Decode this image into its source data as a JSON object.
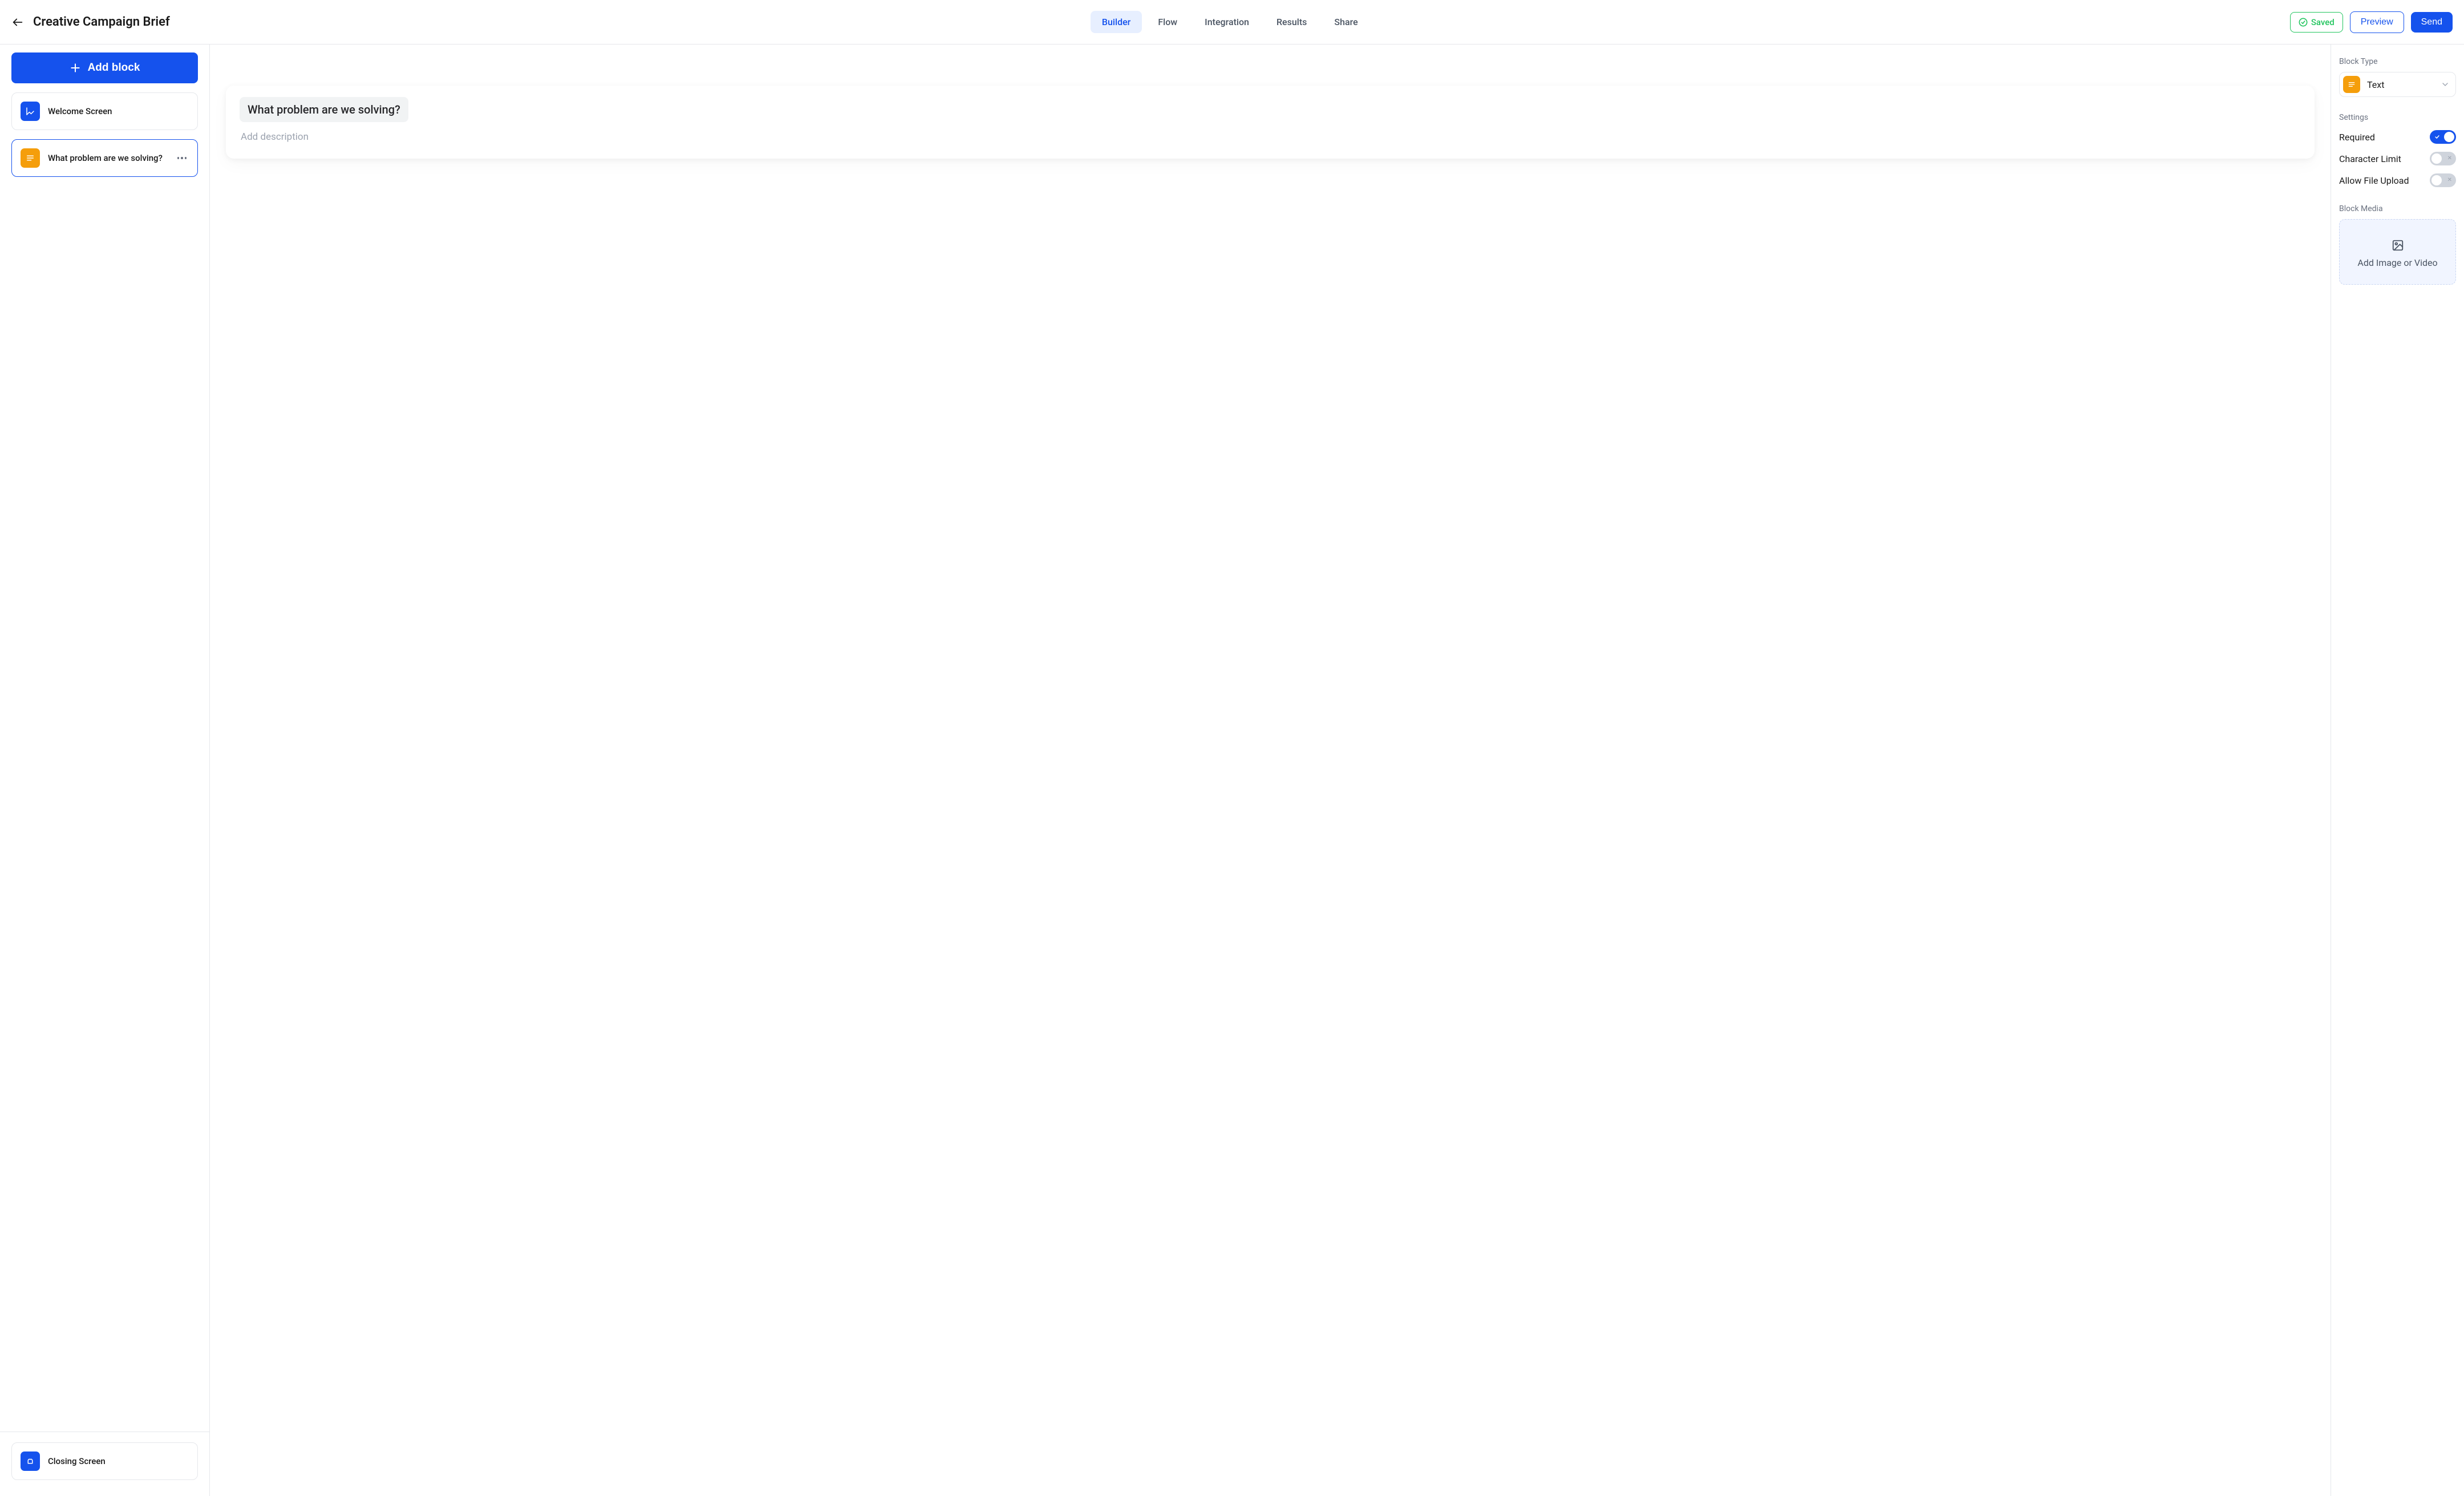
{
  "header": {
    "title": "Creative Campaign Brief",
    "tabs": [
      "Builder",
      "Flow",
      "Integration",
      "Results",
      "Share"
    ],
    "active_tab_index": 0,
    "saved_label": "Saved",
    "preview_label": "Preview",
    "send_label": "Send"
  },
  "sidebar": {
    "add_block_label": "Add block",
    "blocks": [
      {
        "label": "Welcome Screen",
        "icon": "welcome",
        "color": "blue"
      },
      {
        "label": "What problem are we solving?",
        "icon": "text",
        "color": "orange"
      }
    ],
    "selected_block_index": 1,
    "closing": {
      "label": "Closing Screen",
      "icon": "closing",
      "color": "blue"
    }
  },
  "canvas": {
    "question": "What problem are we solving?",
    "description_placeholder": "Add description"
  },
  "right": {
    "block_type_label": "Block Type",
    "block_type_value": "Text",
    "settings_label": "Settings",
    "settings": [
      {
        "label": "Required",
        "on": true
      },
      {
        "label": "Character Limit",
        "on": false
      },
      {
        "label": "Allow File Upload",
        "on": false
      }
    ],
    "media_label": "Block Media",
    "media_drop_label": "Add Image or Video"
  }
}
